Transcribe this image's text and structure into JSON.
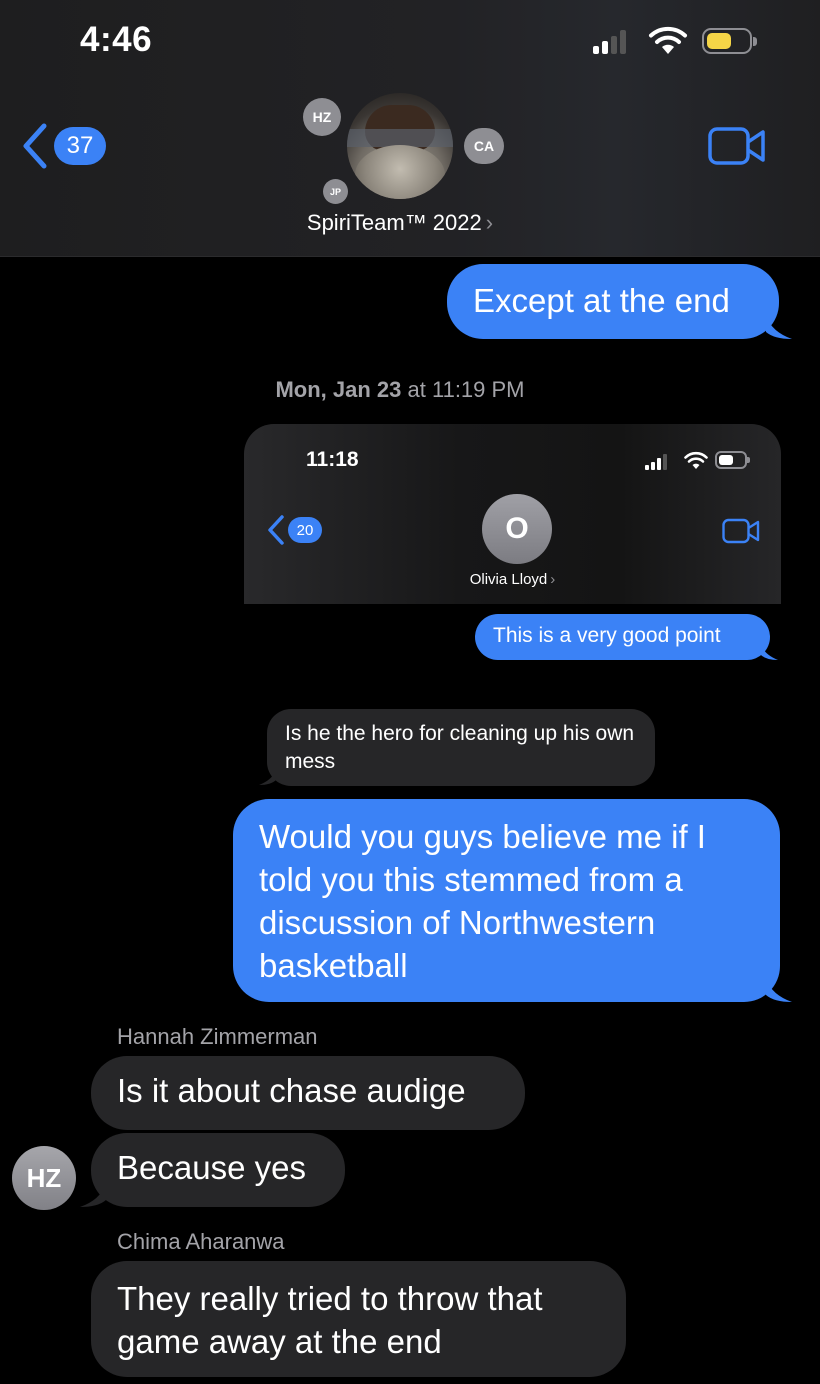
{
  "status_bar": {
    "time": "4:46"
  },
  "header": {
    "back_count": "37",
    "group_name": "SpiriTeam™ 2022",
    "chevron": "›",
    "members": [
      "HZ",
      "CA",
      "JP"
    ]
  },
  "messages": [
    {
      "type": "outgoing",
      "text": "Except at the end"
    },
    {
      "type": "outgoing-image-caption",
      "text": "This is a very good point"
    },
    {
      "type": "incoming",
      "text": "Is he the hero for cleaning up his own mess"
    },
    {
      "type": "outgoing",
      "text": "Would you guys believe me if I told you this stemmed from a discussion of Northwestern basketball"
    },
    {
      "type": "incoming",
      "sender": "Hannah Zimmerman",
      "text": "Is it about chase audige"
    },
    {
      "type": "incoming",
      "sender": "Hannah Zimmerman",
      "text": "Because yes",
      "avatar": "HZ"
    },
    {
      "type": "incoming",
      "sender": "Chima Aharanwa",
      "text": "They really tried to throw that game away at the end"
    }
  ],
  "timestamp": {
    "day": "Mon, Jan 23",
    "time": "at 11:19 PM"
  },
  "screenshot_attachment": {
    "time": "11:18",
    "back_count": "20",
    "contact_initial": "O",
    "contact_name": "Olivia Lloyd",
    "chevron": "›"
  },
  "senders": {
    "hannah": "Hannah Zimmerman",
    "chima": "Chima Aharanwa"
  },
  "colors": {
    "outgoing": "#3b82f6",
    "incoming": "#262628",
    "background": "#000000",
    "battery": "#f5d547"
  }
}
